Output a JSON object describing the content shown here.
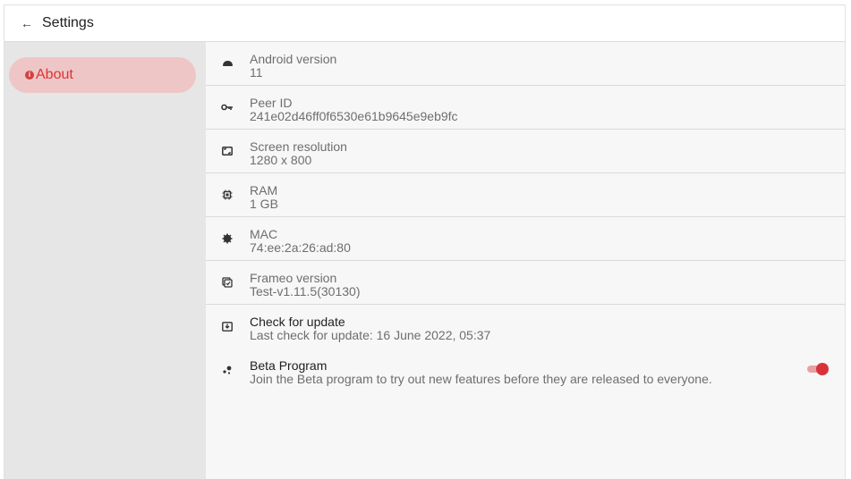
{
  "header": {
    "back_icon": "arrow-left-icon",
    "title": "Settings"
  },
  "sidebar": {
    "items": [
      {
        "label": "About",
        "icon": "info-icon",
        "icon_glyph": "i",
        "active": true
      }
    ]
  },
  "about": {
    "rows": [
      {
        "icon": "android-icon",
        "title": "Android version",
        "value": "11"
      },
      {
        "icon": "key-icon",
        "title": "Peer ID",
        "value": "241e02d46ff0f6530e61b9645e9eb9fc"
      },
      {
        "icon": "screen-resolution-icon",
        "title": "Screen resolution",
        "value": "1280 x 800"
      },
      {
        "icon": "memory-chip-icon",
        "title": "RAM",
        "value": "1 GB"
      },
      {
        "icon": "gear-icon",
        "title": "MAC",
        "value": "74:ee:2a:26:ad:80"
      },
      {
        "icon": "app-version-icon",
        "title": "Frameo version",
        "value": "Test-v1.11.5(30130)"
      },
      {
        "icon": "system-update-icon",
        "title": "Check for update",
        "value": "Last check for update: 16 June 2022, 05:37"
      },
      {
        "icon": "beta-icon",
        "title": "Beta Program",
        "value": "Join the Beta program to try out new features before they are released to everyone.",
        "toggle_on": true
      }
    ]
  },
  "colors": {
    "accent": "#d9323a",
    "active_bg": "#efc6c6",
    "sidebar_bg": "#e6e6e6"
  }
}
